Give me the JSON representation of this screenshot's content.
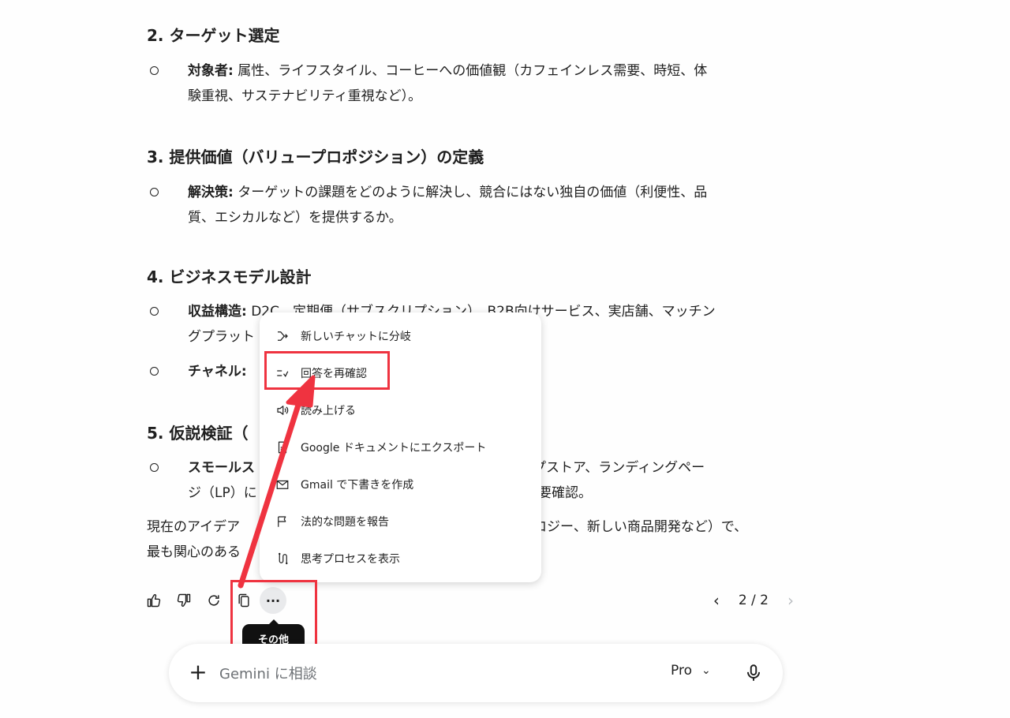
{
  "sections": [
    {
      "title": "2. ターゲット選定",
      "bullets": [
        {
          "label": "対象者:",
          "line1": " 属性、ライフスタイル、コーヒーへの価値観（カフェインレス需要、時短、体",
          "line2": "験重視、サステナビリティ重視など）。"
        }
      ]
    },
    {
      "title": "3. 提供価値（バリュープロポジション）の定義",
      "bullets": [
        {
          "label": "解決策:",
          "line1": " ターゲットの課題をどのように解決し、競合にはない独自の価値（利便性、品",
          "line2": "質、エシカルなど）を提供するか。"
        }
      ]
    },
    {
      "title": "4. ビジネスモデル設計",
      "bullets": [
        {
          "label": "収益構造:",
          "line1": " D2C、定期便（サブスクリプション）、B2B向けサービス、実店舗、マッチン",
          "line2": "グプラット"
        },
        {
          "label": "チャネル:",
          "line1": ""
        }
      ]
    },
    {
      "title": "5. 仮説検証（",
      "bullets": [
        {
          "label": "スモールス",
          "line1": "プアップストア、ランディングペー",
          "line2": "ジ（LP）に",
          "line2b": "要確認。"
        }
      ]
    }
  ],
  "closing": {
    "line1": "現在のアイデア",
    "line1b": "ロジー、新しい商品開発など）で、",
    "line2": "最も関心のある"
  },
  "menu": {
    "items": [
      {
        "label": "新しいチャットに分岐",
        "icon": "branch-icon"
      },
      {
        "label": "回答を再確認",
        "icon": "double-check-icon"
      },
      {
        "label": "読み上げる",
        "icon": "speaker-icon"
      },
      {
        "label": "Google ドキュメントにエクスポート",
        "icon": "document-icon"
      },
      {
        "label": "Gmail で下書きを作成",
        "icon": "mail-icon"
      },
      {
        "label": "法的な問題を報告",
        "icon": "flag-icon"
      },
      {
        "label": "思考プロセスを表示",
        "icon": "thinking-icon"
      }
    ]
  },
  "actions": {
    "tooltip": "その他",
    "more_label": "···",
    "pager": {
      "text": "2 / 2",
      "prev": "‹",
      "next": "›"
    }
  },
  "input": {
    "placeholder": "Gemini に相談",
    "plus": "+",
    "model": "Pro",
    "model_chevron": "⌄"
  },
  "colors": {
    "highlight": "#ef3340",
    "tooltip_bg": "#111111"
  }
}
